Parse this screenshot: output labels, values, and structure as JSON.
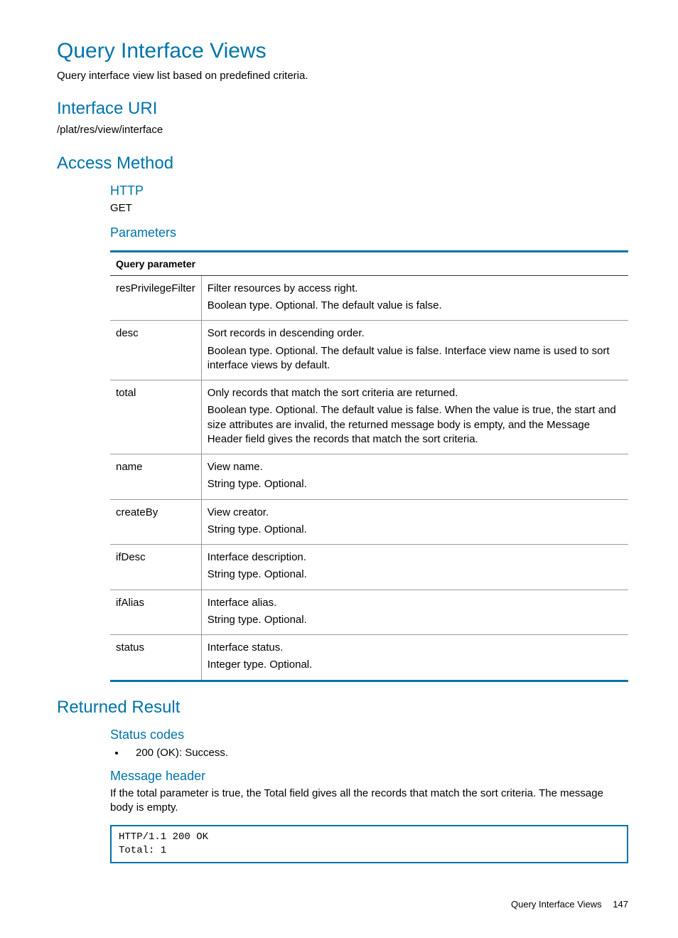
{
  "title": "Query Interface Views",
  "intro": "Query interface view list based on predefined criteria.",
  "interface_uri": {
    "heading": "Interface URI",
    "value": "/plat/res/view/interface"
  },
  "access_method": {
    "heading": "Access Method",
    "http_label": "HTTP",
    "http_value": "GET",
    "params_label": "Parameters",
    "table_header": "Query parameter",
    "params": [
      {
        "name": "resPrivilegeFilter",
        "summary": "Filter resources by access right.",
        "detail": "Boolean type. Optional. The default value is false."
      },
      {
        "name": "desc",
        "summary": "Sort records in descending order.",
        "detail": "Boolean type. Optional. The default value is false. Interface view name is used to sort interface views by default."
      },
      {
        "name": "total",
        "summary": "Only records that match the sort criteria are returned.",
        "detail": "Boolean type. Optional. The default value is false. When the value is true, the start and size attributes are invalid, the returned message body is empty, and the Message Header field gives the records that match the sort criteria."
      },
      {
        "name": "name",
        "summary": "View name.",
        "detail": "String type. Optional."
      },
      {
        "name": "createBy",
        "summary": "View creator.",
        "detail": "String type. Optional."
      },
      {
        "name": "ifDesc",
        "summary": "Interface description.",
        "detail": "String type. Optional."
      },
      {
        "name": "ifAlias",
        "summary": "Interface alias.",
        "detail": "String type. Optional."
      },
      {
        "name": "status",
        "summary": "Interface status.",
        "detail": "Integer type. Optional."
      }
    ]
  },
  "returned_result": {
    "heading": "Returned Result",
    "status_codes_label": "Status codes",
    "status_codes": [
      "200 (OK): Success."
    ],
    "message_header_label": "Message header",
    "message_header_text": "If the total parameter is true, the Total field gives all the records that match the sort criteria. The message body is empty.",
    "code_block": "HTTP/1.1 200 OK\nTotal: 1"
  },
  "footer": {
    "label": "Query Interface Views",
    "page": "147"
  }
}
